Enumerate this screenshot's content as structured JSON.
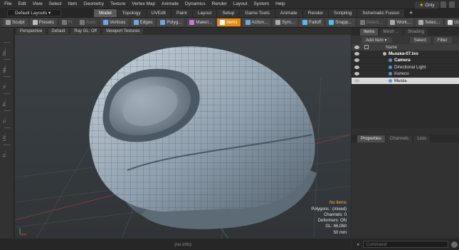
{
  "menu": [
    "File",
    "Edit",
    "View",
    "Select",
    "Item",
    "Geometry",
    "Texture",
    "Vertex Map",
    "Animate",
    "Dynamics",
    "Render",
    "Layout",
    "System",
    "Help"
  ],
  "layouts_dropdown": "Default Layouts ▾",
  "tabs": [
    {
      "label": "Model",
      "active": true
    },
    {
      "label": "Topology",
      "active": false
    },
    {
      "label": "UVEdit",
      "active": false
    },
    {
      "label": "Paint",
      "active": false
    },
    {
      "label": "Layout",
      "active": false
    },
    {
      "label": "Setup",
      "active": false
    },
    {
      "label": "Game Tools",
      "active": false
    },
    {
      "label": "Animate",
      "active": false
    },
    {
      "label": "Render",
      "active": false
    },
    {
      "label": "Scripting",
      "active": false
    },
    {
      "label": "Schematic Fusion",
      "active": false
    }
  ],
  "only_button": "Only",
  "toolbar": [
    {
      "label": "Sculpt",
      "icon": "sculpt-icon",
      "color": "#9a9a9a",
      "state": "normal"
    },
    {
      "label": "Presets",
      "icon": "presets-icon",
      "color": "#bdbdbd",
      "state": "normal"
    },
    {
      "label": "Fi",
      "icon": "fill-icon",
      "color": "#777",
      "state": "dim"
    },
    {
      "label": "Auto",
      "icon": "auto-icon",
      "color": "#777",
      "state": "dim"
    },
    {
      "label": "Vertices",
      "icon": "vertices-icon",
      "color": "#6fa8dc",
      "state": "normal"
    },
    {
      "label": "Edges",
      "icon": "edges-icon",
      "color": "#6fa8dc",
      "state": "normal"
    },
    {
      "label": "Polyg...",
      "icon": "polygons-icon",
      "color": "#6fa8dc",
      "state": "normal"
    },
    {
      "label": "Materi...",
      "icon": "materials-icon",
      "color": "#c678dd",
      "state": "normal"
    },
    {
      "label": "Items",
      "icon": "items-icon",
      "color": "#ffffff",
      "state": "active"
    },
    {
      "label": "Action...",
      "icon": "action-icon",
      "color": "#6fa8dc",
      "state": "normal"
    },
    {
      "label": "Sym...",
      "icon": "symmetry-icon",
      "color": "#aaaaaa",
      "state": "normal"
    },
    {
      "label": "Falloff",
      "icon": "falloff-icon",
      "color": "#4fc1e9",
      "state": "normal"
    },
    {
      "label": "Snapp...",
      "icon": "snapping-icon",
      "color": "#4fc1e9",
      "state": "normal"
    },
    {
      "label": "Select...",
      "icon": "select-icon",
      "color": "#777",
      "state": "dim"
    },
    {
      "label": "Work...",
      "icon": "workplane-icon",
      "color": "#aaaaaa",
      "state": "normal"
    },
    {
      "label": "Selec...",
      "icon": "selection-sets-icon",
      "color": "#aaaaaa",
      "state": "normal"
    },
    {
      "label": "Unre...",
      "icon": "unreal-icon",
      "color": "#dddddd",
      "state": "normal"
    }
  ],
  "left_tools": [
    "Du...",
    "Me...",
    "V...",
    "Pc...",
    "C...",
    "UV...",
    "Fi..."
  ],
  "viewport": {
    "header": [
      "Perspective",
      "Default",
      "Ray GL: Off",
      "Viewport Textures"
    ],
    "info": {
      "no_items": "No Items",
      "polygons": "Polygons : (mixed)",
      "channels": "Channels: 0",
      "deformers": "Deformers: ON",
      "gl": "GL: 66,060",
      "scale": "50 mm"
    }
  },
  "status_info": "(no info)",
  "right_panel": {
    "tabs": [
      {
        "label": "Items",
        "active": true
      },
      {
        "label": "Mesh ...",
        "active": false
      },
      {
        "label": "Shading",
        "active": false
      }
    ],
    "add_item": "Add Item ▾",
    "select": "Select",
    "filter": "Filter",
    "column_name": "Name",
    "tree": [
      {
        "label": "Мышка-07.lxo",
        "depth": 0,
        "style": "hl"
      },
      {
        "label": "Camera",
        "depth": 1,
        "style": "hl"
      },
      {
        "label": "Directional Light",
        "depth": 1,
        "style": "normal"
      },
      {
        "label": "Колесо",
        "depth": 1,
        "style": "normal"
      },
      {
        "label": "Мышь",
        "depth": 1,
        "style": "sel"
      }
    ],
    "props_tabs": [
      {
        "label": "Properties",
        "active": true
      },
      {
        "label": "Channels",
        "active": false
      },
      {
        "label": "Lists",
        "active": false
      }
    ],
    "command_placeholder": "Command"
  }
}
